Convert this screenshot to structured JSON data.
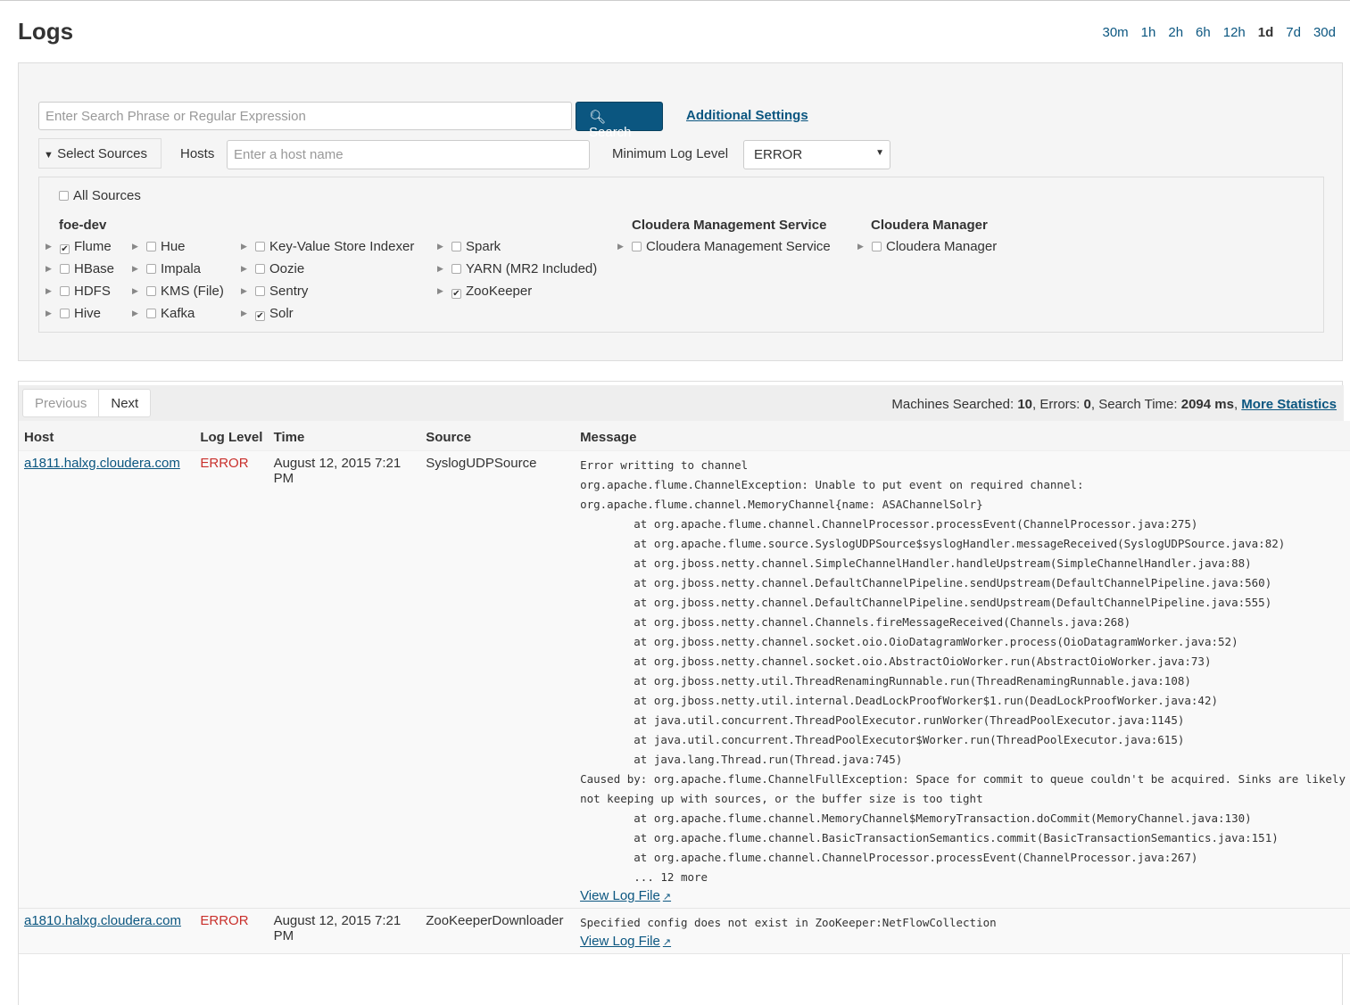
{
  "title": "Logs",
  "time_ranges": [
    "30m",
    "1h",
    "2h",
    "6h",
    "12h",
    "1d",
    "7d",
    "30d"
  ],
  "active_range": "1d",
  "search": {
    "placeholder": "Enter Search Phrase or Regular Expression",
    "button": "Search",
    "additional": "Additional Settings"
  },
  "select_sources": "Select Sources",
  "hosts": {
    "label": "Hosts",
    "placeholder": "Enter a host name"
  },
  "min_level": {
    "label": "Minimum Log Level",
    "value": "ERROR"
  },
  "all_sources": "All Sources",
  "groups": [
    {
      "name": "foe-dev"
    },
    {
      "name": "Cloudera Management Service"
    },
    {
      "name": "Cloudera Manager"
    }
  ],
  "sources": [
    [
      {
        "label": "Flume",
        "checked": true
      },
      {
        "label": "HBase",
        "checked": false
      },
      {
        "label": "HDFS",
        "checked": false
      },
      {
        "label": "Hive",
        "checked": false
      }
    ],
    [
      {
        "label": "Hue",
        "checked": false
      },
      {
        "label": "Impala",
        "checked": false
      },
      {
        "label": "KMS (File)",
        "checked": false
      },
      {
        "label": "Kafka",
        "checked": false
      }
    ],
    [
      {
        "label": "Key-Value Store Indexer",
        "checked": false
      },
      {
        "label": "Oozie",
        "checked": false
      },
      {
        "label": "Sentry",
        "checked": false
      },
      {
        "label": "Solr",
        "checked": true
      }
    ],
    [
      {
        "label": "Spark",
        "checked": false
      },
      {
        "label": "YARN (MR2 Included)",
        "checked": false
      },
      {
        "label": "ZooKeeper",
        "checked": true
      }
    ],
    [
      {
        "label": "Cloudera Management Service",
        "checked": false
      }
    ],
    [
      {
        "label": "Cloudera Manager",
        "checked": false
      }
    ]
  ],
  "pager": {
    "prev": "Previous",
    "next": "Next"
  },
  "stats": {
    "machines_label": "Machines Searched: ",
    "machines": "10",
    "errors_label": ", Errors: ",
    "errors": "0",
    "time_label": ", Search Time: ",
    "time": "2094 ms",
    "sep": ", ",
    "more": "More Statistics"
  },
  "columns": [
    "Host",
    "Log Level",
    "Time",
    "Source",
    "Message"
  ],
  "rows": [
    {
      "host": "a1811.halxg.cloudera.com",
      "level": "ERROR",
      "time": "August 12, 2015 7:21 PM",
      "source": "SyslogUDPSource",
      "message": "Error writting to channel\norg.apache.flume.ChannelException: Unable to put event on required channel:\norg.apache.flume.channel.MemoryChannel{name: ASAChannelSolr}\n\tat org.apache.flume.channel.ChannelProcessor.processEvent(ChannelProcessor.java:275)\n\tat org.apache.flume.source.SyslogUDPSource$syslogHandler.messageReceived(SyslogUDPSource.java:82)\n\tat org.jboss.netty.channel.SimpleChannelHandler.handleUpstream(SimpleChannelHandler.java:88)\n\tat org.jboss.netty.channel.DefaultChannelPipeline.sendUpstream(DefaultChannelPipeline.java:560)\n\tat org.jboss.netty.channel.DefaultChannelPipeline.sendUpstream(DefaultChannelPipeline.java:555)\n\tat org.jboss.netty.channel.Channels.fireMessageReceived(Channels.java:268)\n\tat org.jboss.netty.channel.socket.oio.OioDatagramWorker.process(OioDatagramWorker.java:52)\n\tat org.jboss.netty.channel.socket.oio.AbstractOioWorker.run(AbstractOioWorker.java:73)\n\tat org.jboss.netty.util.ThreadRenamingRunnable.run(ThreadRenamingRunnable.java:108)\n\tat org.jboss.netty.util.internal.DeadLockProofWorker$1.run(DeadLockProofWorker.java:42)\n\tat java.util.concurrent.ThreadPoolExecutor.runWorker(ThreadPoolExecutor.java:1145)\n\tat java.util.concurrent.ThreadPoolExecutor$Worker.run(ThreadPoolExecutor.java:615)\n\tat java.lang.Thread.run(Thread.java:745)\nCaused by: org.apache.flume.ChannelFullException: Space for commit to queue couldn't be acquired. Sinks are likely\nnot keeping up with sources, or the buffer size is too tight\n\tat org.apache.flume.channel.MemoryChannel$MemoryTransaction.doCommit(MemoryChannel.java:130)\n\tat org.apache.flume.channel.BasicTransactionSemantics.commit(BasicTransactionSemantics.java:151)\n\tat org.apache.flume.channel.ChannelProcessor.processEvent(ChannelProcessor.java:267)\n\t... 12 more",
      "view": "View Log File"
    },
    {
      "host": "a1810.halxg.cloudera.com",
      "level": "ERROR",
      "time": "August 12, 2015 7:21 PM",
      "source": "ZooKeeperDownloader",
      "message": "Specified config does not exist in ZooKeeper:NetFlowCollection",
      "view": "View Log File"
    }
  ]
}
